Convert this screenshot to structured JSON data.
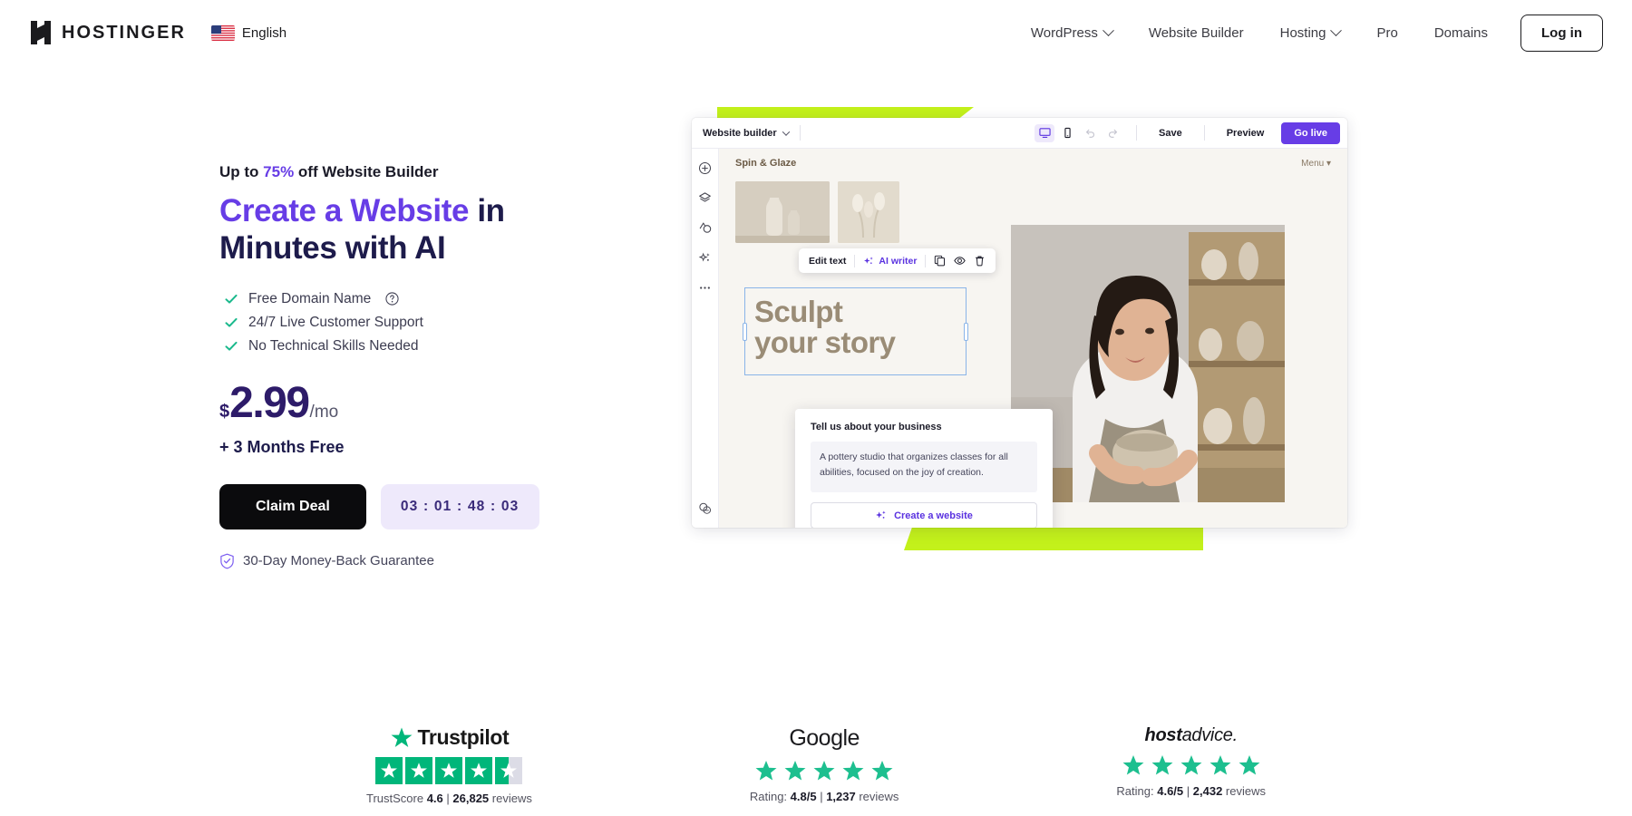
{
  "header": {
    "brand_name": "HOSTINGER",
    "language": "English",
    "nav": [
      {
        "label": "WordPress",
        "has_dropdown": true
      },
      {
        "label": "Website Builder",
        "has_dropdown": false
      },
      {
        "label": "Hosting",
        "has_dropdown": true
      },
      {
        "label": "Pro",
        "has_dropdown": false
      },
      {
        "label": "Domains",
        "has_dropdown": false
      }
    ],
    "login_label": "Log in"
  },
  "hero": {
    "eyebrow_pre": "Up to ",
    "eyebrow_pct": "75%",
    "eyebrow_post": " off Website Builder",
    "headline_accent": "Create a Website",
    "headline_rest": " in Minutes with AI",
    "features": [
      "Free Domain Name",
      "24/7 Live Customer Support",
      "No Technical Skills Needed"
    ],
    "price_currency": "$",
    "price_amount": "2.99",
    "price_period": "/mo",
    "bonus": "+ 3 Months Free",
    "cta_label": "Claim Deal",
    "timer": "03 : 01 : 48 : 03",
    "guarantee": "30-Day Money-Back Guarantee",
    "accent_color": "#673de6",
    "headline_color": "#1d1b4b"
  },
  "builder": {
    "topbar": {
      "workspace": "Website builder",
      "save": "Save",
      "preview": "Preview",
      "golive": "Go live",
      "icons": [
        "desktop-icon",
        "mobile-icon",
        "undo-icon",
        "redo-icon"
      ]
    },
    "sidebar_icons": [
      "add-element-icon",
      "layers-icon",
      "brand-icon",
      "ai-sparkle-icon",
      "more-options-icon",
      "help-chat-icon"
    ],
    "canvas": {
      "site_name": "Spin & Glaze",
      "menu_label": "Menu",
      "heading_line1": "Sculpt",
      "heading_line2": "your story"
    },
    "edit_toolbar": {
      "edit_text": "Edit text",
      "ai_writer": "AI writer",
      "icons": [
        "duplicate-icon",
        "visibility-icon",
        "delete-icon"
      ]
    },
    "ai_card": {
      "title": "Tell us about your business",
      "description": "A pottery studio that organizes classes for all abilities, focused on the joy of creation.",
      "button_label": "Create a website"
    },
    "accent_green": "#c3f11b",
    "accent_purple": "#673de6"
  },
  "trust": [
    {
      "brand": "Trustpilot",
      "stars_full": 4,
      "stars_half": 1,
      "meta_prefix": "TrustScore ",
      "score": "4.6",
      "separator": "  |  ",
      "reviews_count": "26,825",
      "meta_suffix": " reviews",
      "star_color": "#00b67a"
    },
    {
      "brand": "Google",
      "stars_full": 5,
      "stars_half": 0,
      "meta_prefix": "Rating: ",
      "score": "4.8/5",
      "separator": " | ",
      "reviews_count": "1,237",
      "meta_suffix": " reviews",
      "star_color": "#00b67a"
    },
    {
      "brand_bold": "host",
      "brand_rest": "advice.",
      "brand": "hostadvice.",
      "stars_full": 5,
      "stars_half": 0,
      "meta_prefix": "Rating: ",
      "score": "4.6/5",
      "separator": " | ",
      "reviews_count": "2,432",
      "meta_suffix": " reviews",
      "star_color": "#00b67a"
    }
  ]
}
